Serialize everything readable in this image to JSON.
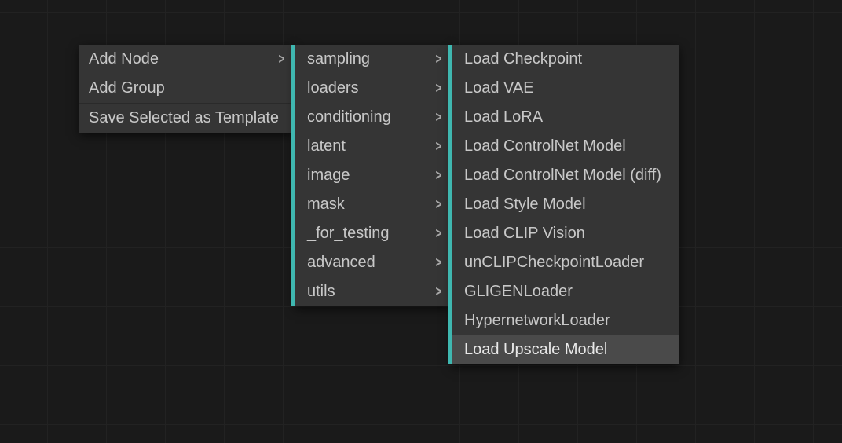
{
  "contextMenu": {
    "level1": {
      "items": [
        {
          "label": "Add Node",
          "hasSubmenu": true,
          "highlighted": false
        },
        {
          "label": "Add Group",
          "hasSubmenu": false,
          "highlighted": false
        }
      ],
      "afterDivider": [
        {
          "label": "Save Selected as Template",
          "hasSubmenu": false,
          "highlighted": false
        }
      ]
    },
    "level2": {
      "items": [
        {
          "label": "sampling",
          "hasSubmenu": true
        },
        {
          "label": "loaders",
          "hasSubmenu": true
        },
        {
          "label": "conditioning",
          "hasSubmenu": true
        },
        {
          "label": "latent",
          "hasSubmenu": true
        },
        {
          "label": "image",
          "hasSubmenu": true
        },
        {
          "label": "mask",
          "hasSubmenu": true
        },
        {
          "label": "_for_testing",
          "hasSubmenu": true
        },
        {
          "label": "advanced",
          "hasSubmenu": true
        },
        {
          "label": "utils",
          "hasSubmenu": true
        }
      ]
    },
    "level3": {
      "items": [
        {
          "label": "Load Checkpoint",
          "highlighted": false
        },
        {
          "label": "Load VAE",
          "highlighted": false
        },
        {
          "label": "Load LoRA",
          "highlighted": false
        },
        {
          "label": "Load ControlNet Model",
          "highlighted": false
        },
        {
          "label": "Load ControlNet Model (diff)",
          "highlighted": false
        },
        {
          "label": "Load Style Model",
          "highlighted": false
        },
        {
          "label": "Load CLIP Vision",
          "highlighted": false
        },
        {
          "label": "unCLIPCheckpointLoader",
          "highlighted": false
        },
        {
          "label": "GLIGENLoader",
          "highlighted": false
        },
        {
          "label": "HypernetworkLoader",
          "highlighted": false
        },
        {
          "label": "Load Upscale Model",
          "highlighted": true
        }
      ]
    }
  },
  "colors": {
    "accent": "#3fb7b0",
    "menuBg": "#353535",
    "menuHighlight": "#4a4a4a",
    "canvasBg": "#1a1a1a"
  }
}
